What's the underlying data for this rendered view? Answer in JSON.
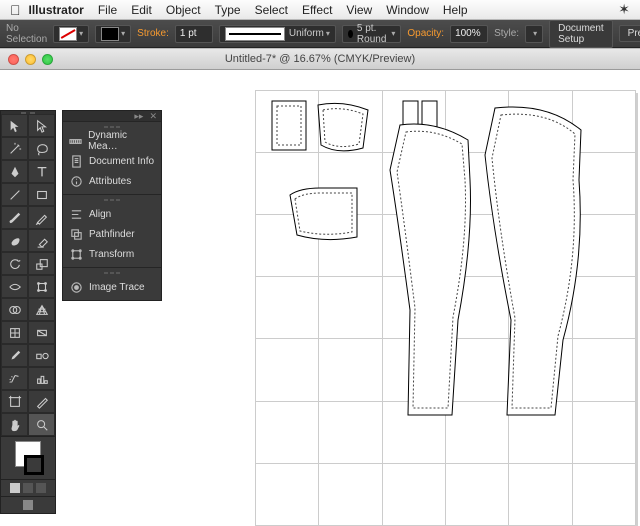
{
  "menubar": {
    "app": "Illustrator",
    "items": [
      "File",
      "Edit",
      "Object",
      "Type",
      "Select",
      "Effect",
      "View",
      "Window",
      "Help"
    ]
  },
  "control_bar": {
    "selection": "No Selection",
    "stroke_label": "Stroke:",
    "stroke_weight": "1 pt",
    "stroke_profile": "Uniform",
    "brush_label": "5 pt. Round",
    "opacity_label": "Opacity:",
    "opacity_value": "100%",
    "style_label": "Style:",
    "doc_setup": "Document Setup",
    "prefs": "Pre"
  },
  "window": {
    "title": "Untitled-7* @ 16.67% (CMYK/Preview)"
  },
  "flyout": {
    "group1": [
      {
        "icon": "measure",
        "label": "Dynamic Mea…"
      },
      {
        "icon": "docinfo",
        "label": "Document Info"
      },
      {
        "icon": "circle-i",
        "label": "Attributes"
      }
    ],
    "group2": [
      {
        "icon": "align",
        "label": "Align"
      },
      {
        "icon": "pathfinder",
        "label": "Pathfinder"
      },
      {
        "icon": "transform",
        "label": "Transform"
      }
    ],
    "group3": [
      {
        "icon": "trace",
        "label": "Image Trace"
      }
    ]
  },
  "tool_names": [
    "selection-tool",
    "direct-selection-tool",
    "magic-wand-tool",
    "lasso-tool",
    "pen-tool",
    "type-tool",
    "line-segment-tool",
    "rectangle-tool",
    "paintbrush-tool",
    "pencil-tool",
    "blob-brush-tool",
    "eraser-tool",
    "rotate-tool",
    "scale-tool",
    "width-tool",
    "free-transform-tool",
    "shape-builder-tool",
    "perspective-grid-tool",
    "mesh-tool",
    "gradient-tool",
    "eyedropper-tool",
    "blend-tool",
    "symbol-sprayer-tool",
    "column-graph-tool",
    "artboard-tool",
    "slice-tool",
    "hand-tool",
    "zoom-tool"
  ],
  "colors": {
    "panel": "#3a3a3a",
    "panel_dark": "#2e2e2e",
    "accent": "#f79a2f"
  }
}
